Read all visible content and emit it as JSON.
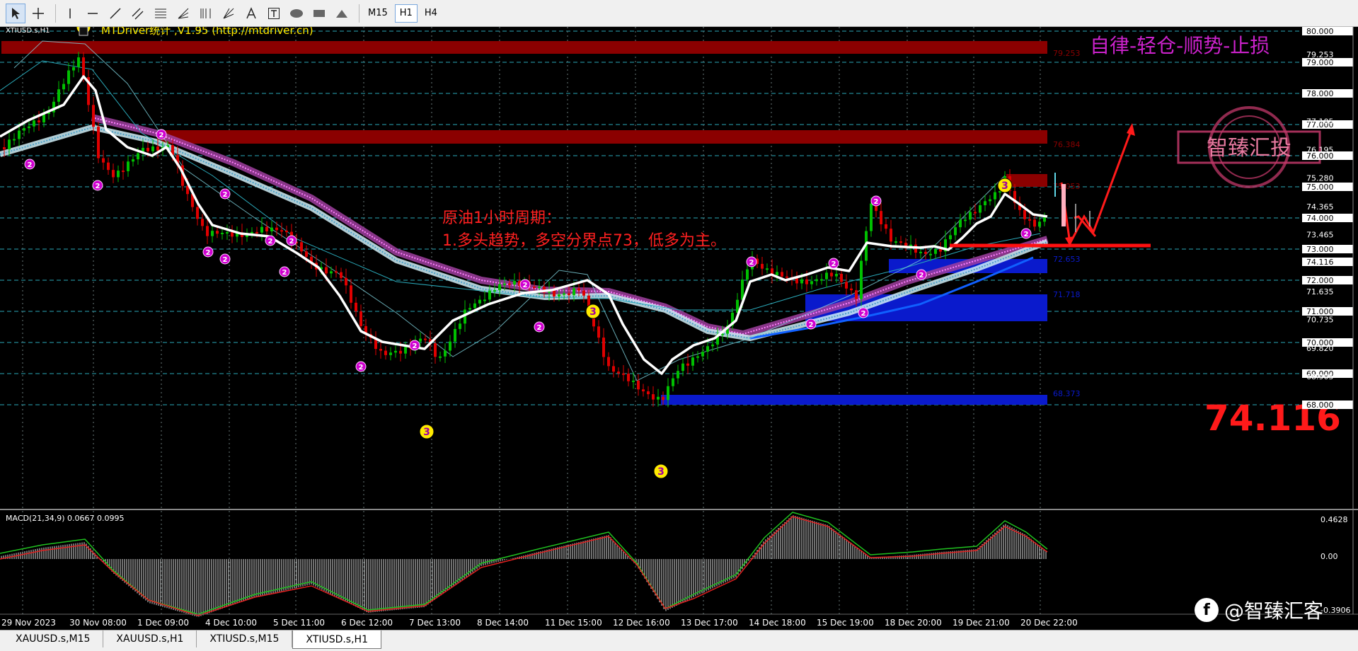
{
  "toolbar": {
    "timeframes": [
      "M15",
      "H1",
      "H4"
    ],
    "active_timeframe": "H1"
  },
  "chart": {
    "symbol_label": "XTIUSD.s,H1",
    "indicator_banner": "MTDriver统计 ,V1.95 (http://mtdriver.cn)",
    "motto": "自律-轻仓-顺势-止损",
    "stamp_text": "智臻汇投",
    "analysis_title": "原油1小时周期：",
    "analysis_line1": "1.多头趋势，多空分界点73，低多为主。",
    "big_price": "74.116",
    "colors": {
      "bull_candle": "#00c000",
      "bear_candle": "#e00000",
      "ma_white": "#ffffff",
      "resistance_zone": "#8b0000",
      "support_zone": "#0a1acc",
      "annotation_red": "#ff2020",
      "marker_yellow": "#ffea00",
      "marker_magenta": "#d000d0",
      "grid": "#2aa9b9",
      "motto": "#cc22cc"
    },
    "price_axis": [
      "80.000",
      "79.000",
      "78.000",
      "77.000",
      "76.000",
      "75.000",
      "74.000",
      "73.000",
      "72.000",
      "71.000",
      "70.000",
      "69.000",
      "68.000"
    ],
    "price_axis_mid": [
      "79.253",
      "77.105",
      "76.195",
      "75.280",
      "74.365",
      "73.465",
      "72.550",
      "71.635",
      "70.735",
      "69.820",
      "68.905"
    ],
    "current_price_tag": "74.116",
    "zone_labels": [
      "79.253",
      "76.384",
      "75.053",
      "72.653",
      "71.718",
      "68.373"
    ],
    "macd_label": "MACD(21,34,9) 0.0667 0.0995",
    "macd_axis": [
      "0.4628",
      "0.00",
      "-0.3906"
    ],
    "time_axis": [
      "29 Nov 2023",
      "30 Nov 08:00",
      "1 Dec 09:00",
      "4 Dec 10:00",
      "5 Dec 11:00",
      "6 Dec 12:00",
      "7 Dec 13:00",
      "8 Dec 14:00",
      "11 Dec 15:00",
      "12 Dec 16:00",
      "13 Dec 17:00",
      "14 Dec 18:00",
      "15 Dec 19:00",
      "18 Dec 20:00",
      "19 Dec 21:00",
      "20 Dec 22:00"
    ]
  },
  "tabs": [
    "XAUUSD.s,M15",
    "XAUUSD.s,H1",
    "XTIUSD.s,M15",
    "XTIUSD.s,H1"
  ],
  "active_tab": "XTIUSD.s,H1",
  "watermark": {
    "logo": "f",
    "text": "@智臻汇客"
  }
}
